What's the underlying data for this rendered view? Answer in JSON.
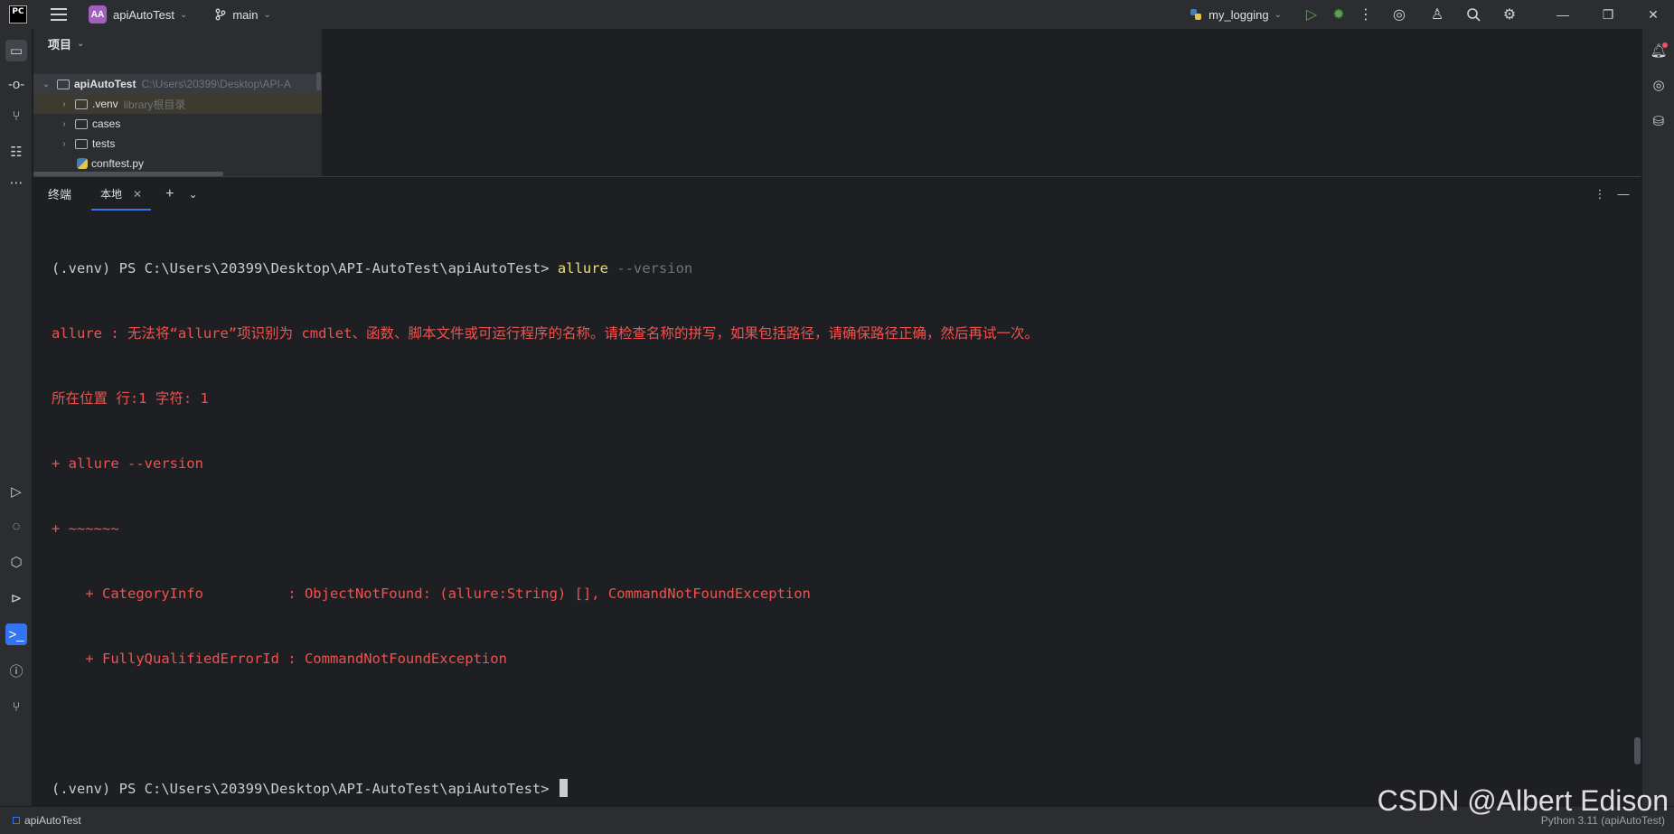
{
  "titlebar": {
    "logo_text": "PC",
    "project_badge": "AA",
    "project_name": "apiAutoTest",
    "branch": "main",
    "run_config": "my_logging",
    "icons": [
      "menu-icon",
      "branch-icon",
      "python-icon",
      "run-icon",
      "debug-icon",
      "more-icon",
      "ai-assistant-icon",
      "add-user-icon",
      "search-icon",
      "settings-icon",
      "minimize-icon",
      "restore-icon",
      "close-icon"
    ]
  },
  "project_panel": {
    "title": "项目",
    "root": {
      "name": "apiAutoTest",
      "path": "C:\\Users\\20399\\Desktop\\API-A"
    },
    "items": [
      {
        "name": ".venv",
        "note": "library根目录"
      },
      {
        "name": "cases",
        "note": ""
      },
      {
        "name": "tests",
        "note": ""
      },
      {
        "name": "conftest.py",
        "note": ""
      }
    ]
  },
  "terminal": {
    "title": "终端",
    "tab_label": "本地",
    "lines": [
      {
        "prompt": "(.venv) PS C:\\Users\\20399\\Desktop\\API-AutoTest\\apiAutoTest> ",
        "cmd": "allure",
        "arg": " --version"
      },
      {
        "err": "allure : 无法将“allure”项识别为 cmdlet、函数、脚本文件或可运行程序的名称。请检查名称的拼写，如果包括路径，请确保路径正确，然后再试一次。"
      },
      {
        "err": "所在位置 行:1 字符: 1"
      },
      {
        "err": "+ allure --version"
      },
      {
        "err": "+ ~~~~~~"
      },
      {
        "err": "    + CategoryInfo          : ObjectNotFound: (allure:String) [], CommandNotFoundException"
      },
      {
        "err": "    + FullyQualifiedErrorId : CommandNotFoundException"
      },
      {
        "blank": ""
      },
      {
        "prompt": "(.venv) PS C:\\Users\\20399\\Desktop\\API-AutoTest\\apiAutoTest> "
      }
    ]
  },
  "statusbar": {
    "project": "apiAutoTest",
    "interpreter": "Python 3.11 (apiAutoTest)"
  },
  "watermark": "CSDN @Albert Edison",
  "colors": {
    "accent": "#3574f0",
    "error": "#f0524f",
    "command": "#e8e16b"
  }
}
